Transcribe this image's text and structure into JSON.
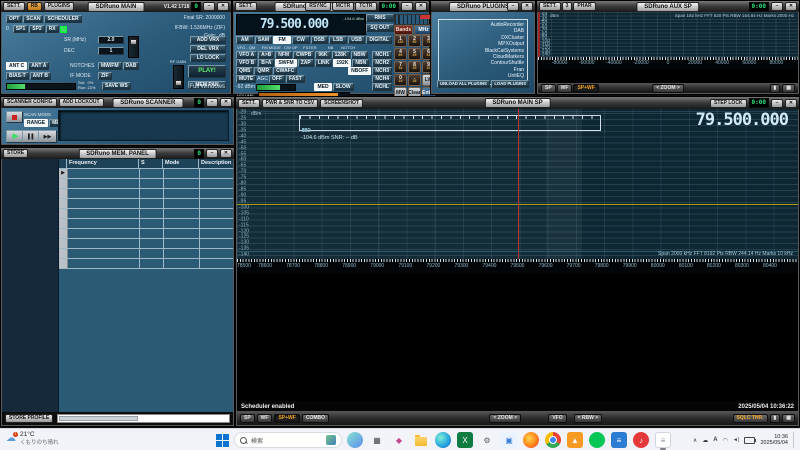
{
  "main_win": {
    "sett": "SETT.",
    "rb": "RB",
    "plugins_btn": "PLUGINS",
    "title": "SDRuno MAIN",
    "version": "V1.42 1718",
    "clock": "0",
    "row1": [
      {
        "t": "OPT"
      },
      {
        "t": "SCAN"
      },
      {
        "t": "SCHEDULER"
      }
    ],
    "final_sr": "Final SR: 2000000",
    "rx_num": "0",
    "row2": [
      {
        "t": "SP1"
      },
      {
        "t": "SP2"
      },
      {
        "t": "RX"
      }
    ],
    "ifbw": "IFBW: 1.536MHz (ZIF)",
    "gain": "Gain:  dB",
    "sr_label": "SR (MHz)",
    "sr_value": "2.0",
    "dec_label": "DEC",
    "dec_value": "1",
    "add_vrx": "ADD VRX",
    "del_vrx": "DEL VRX",
    "lo_lock": "LO LOCK",
    "ant_row1": [
      {
        "t": "ANT C",
        "on": true
      },
      {
        "t": "ANT A"
      }
    ],
    "notches_label": "NOTCHES",
    "notches": [
      {
        "t": "MW/FM"
      },
      {
        "t": "DAB"
      }
    ],
    "ant_row2": [
      {
        "t": "BIAS-T"
      },
      {
        "t": "ANT B"
      }
    ],
    "ifmode_label": "IF MODE",
    "ifmode": "ZIF",
    "rfgain_label": "RF GAIN",
    "play": "PLAY!",
    "mem_pan": "MEM PAN",
    "cpu1": "Sdr:  0%",
    "cpu2": "Run: 22%",
    "save_ws": "SAVE WS",
    "full_windows": "Full Windows"
  },
  "rx_win": {
    "sett": "SETT.",
    "title": "SDRuno RX CONTROL",
    "rbtns": [
      {
        "t": "RSYNC"
      },
      {
        "t": "MCTR"
      },
      {
        "t": "TCTR"
      }
    ],
    "clock": "0:00",
    "freq": "79.500.000",
    "dbm": "-104.6 dBm",
    "rms": "RMS",
    "sq_out": "SQ OUT",
    "modes": [
      {
        "t": "AM"
      },
      {
        "t": "SAM"
      },
      {
        "t": "FM",
        "on": true
      },
      {
        "t": "CW"
      },
      {
        "t": "DSB"
      },
      {
        "t": "LSB"
      },
      {
        "t": "USB"
      },
      {
        "t": "DIGITAL"
      }
    ],
    "col_labels": "VFO - QM      FM MODE   CW OP     FILTER          NB       NOTCH",
    "grid_r1": [
      {
        "t": "VFO A"
      },
      {
        "t": "A>B"
      },
      {
        "t": "NFM"
      },
      {
        "t": "CWPB"
      },
      {
        "t": "96K"
      },
      {
        "t": "128K"
      },
      {
        "t": "NBW"
      },
      {
        "t": "NCH1",
        "cls": "mla"
      }
    ],
    "grid_r2": [
      {
        "t": "VFO B"
      },
      {
        "t": "B>A"
      },
      {
        "t": "SWFM",
        "on": true
      },
      {
        "t": "ZAP"
      },
      {
        "t": "LINK"
      },
      {
        "t": "192K",
        "on": true
      },
      {
        "t": "NBN"
      },
      {
        "t": "NCH2",
        "cls": "mla"
      }
    ],
    "grid_r3": [
      {
        "t": "QMS"
      },
      {
        "t": "QMR"
      },
      {
        "t": "CWAFC"
      },
      {
        "t": "NBOFF",
        "on": true,
        "cls": "mla"
      },
      {
        "t": "NCH3",
        "cls": "mla2"
      }
    ],
    "grid_r4": [
      {
        "t": "MUTE"
      },
      {
        "t": "AGC",
        "cls": "lbl mla"
      },
      {
        "t": "OFF"
      },
      {
        "t": "FAST"
      },
      {
        "t": "NCH4",
        "cls": "mla"
      }
    ],
    "grid_r5": [
      {
        "t": "-92 dBm",
        "cls": "lbl"
      },
      {
        "cls": "gbar"
      },
      {
        "t": "MED",
        "on": true,
        "cls": "mla"
      },
      {
        "t": "SLOW"
      },
      {
        "t": "NCHL",
        "cls": "mla"
      }
    ],
    "volume_label": "VOLUME",
    "keypad_top": [
      {
        "t": "Bands",
        "cls": "kred kwide"
      },
      {
        "t": "MHz",
        "cls": "kblue kwide"
      }
    ],
    "keypad": [
      [
        {
          "t": "1",
          "sub": "120"
        },
        {
          "t": "2",
          "sub": "90"
        },
        {
          "t": "3",
          "sub": "75"
        }
      ],
      [
        {
          "t": "4",
          "sub": "60"
        },
        {
          "t": "5",
          "sub": "49"
        },
        {
          "t": "6",
          "sub": "41"
        }
      ],
      [
        {
          "t": "7",
          "sub": "31"
        },
        {
          "t": "8",
          "sub": "25"
        },
        {
          "t": "9",
          "sub": "22"
        }
      ],
      [
        {
          "t": "0",
          "sub": "19"
        },
        {
          "t": ".",
          "sub": "16"
        },
        {
          "t": "LW",
          "cls": "ksil"
        }
      ],
      [
        {
          "t": "MW",
          "cls": "ksil"
        },
        {
          "t": "Clear",
          "cls": "ksil"
        },
        {
          "t": "Enter",
          "cls": "kblue"
        }
      ]
    ]
  },
  "plugins_win": {
    "title": "SDRuno PLUGINS",
    "items": [
      "AudioRecorder",
      "DAB",
      "DXCluster",
      "MPXOutput",
      "BlackCatSystems",
      "CloudMarkers",
      "ContourShuttle",
      "Fran",
      "UnitEQ"
    ],
    "unload": "UNLOAD ALL PLUGINS",
    "load": "LOAD PLUGINS"
  },
  "aux_win": {
    "lbtns": [
      {
        "t": "SETT."
      },
      {
        "t": "3"
      },
      {
        "t": "PHAR"
      }
    ],
    "title": "SDRuno AUX SP",
    "clock": "0:00",
    "dbm_label": "dBm",
    "info": "Span 192 kHz  FFT 620 Pts  RBW 154.84 Hz  Marks 2000 Hz",
    "y_ticks": [
      "-20",
      "-30",
      "-40",
      "-50",
      "-60",
      "-70",
      "-80",
      "-90",
      "-100",
      "-110",
      "-120",
      "-130",
      "-140"
    ],
    "x_ticks": [
      "-80000",
      "-60000",
      "-40000",
      "-20000",
      "0",
      "20000",
      "40000",
      "60000",
      "80000"
    ],
    "bottom": [
      {
        "t": "SP"
      },
      {
        "t": "WF"
      },
      {
        "t": "SP+WF",
        "on": true
      }
    ],
    "zoom": "<  ZOOM  >",
    "icon1": "▮",
    "icon2": "▦"
  },
  "scanner_win": {
    "config": "SCANNER CONFIG",
    "add_lockout": "ADD LOCKOUT",
    "title": "SDRuno SCANNER",
    "clock": "0",
    "scan_mode": "SCAN MODE",
    "mode_btns": [
      {
        "t": "RANGE",
        "on": true
      },
      {
        "t": "MEM"
      }
    ],
    "play": "▶",
    "pause": "▌▌",
    "skip": "▶▶"
  },
  "mem_win": {
    "store": "STORE",
    "title": "SDRuno MEM. PANEL",
    "clock": "0",
    "columns": [
      "Frequency",
      "S",
      "Mode",
      "Description"
    ],
    "row_count": 10,
    "row_marker": "▶",
    "store_profile": "STORE PROFILE"
  },
  "mainsp_win": {
    "sett": "SETT.",
    "pwr_csv": "PWR & SNR TO CSV",
    "screenshot": "SCREENSHOT",
    "title": "SDRuno MAIN SP",
    "step_lock": "STEP LOCK",
    "clock": "0:00",
    "dbm_label": "dBm",
    "freq": "79.500.000",
    "smeter_ticks": [
      "0",
      "1",
      "2",
      "3",
      "4",
      "5",
      "6",
      "7",
      "8",
      "9",
      "+10",
      "+20",
      "+30",
      "+40",
      "+50",
      "+60"
    ],
    "level_text": "-104.6 dBm    SNR: -- dB",
    "info": "Span 2000 kHz  FFT 8192 Pts  RBW 244.14 Hz  Marks 10 kHz",
    "y_ticks": [
      "-20",
      "-25",
      "-30",
      "-35",
      "-40",
      "-45",
      "-50",
      "-55",
      "-60",
      "-65",
      "-70",
      "-75",
      "-80",
      "-85",
      "-90",
      "-95",
      "-100",
      "-105",
      "-110",
      "-115",
      "-120",
      "-125",
      "-130",
      "-135",
      "-140"
    ],
    "x_ticks": [
      "78500",
      "78600",
      "78700",
      "78800",
      "78900",
      "79000",
      "79100",
      "79200",
      "79300",
      "79400",
      "79500",
      "79600",
      "79700",
      "79800",
      "79900",
      "80000",
      "80100",
      "80200",
      "80300",
      "80400"
    ],
    "scheduler": "Scheduler enabled",
    "timestamp": "2025/05/04 10:36:22",
    "bottom_left": [
      {
        "t": "SP"
      },
      {
        "t": "WF"
      },
      {
        "t": "SP+WF",
        "on": true
      },
      {
        "t": "COMBO"
      }
    ],
    "zoom": "<  ZOOM  >",
    "vfo": "VFO",
    "rbw": "<  RBW  >",
    "sqlc": "SQLC THR.",
    "icon1": "▮",
    "icon2": "▦",
    "squelch_line_dbm": -95,
    "tuned_freq_khz": 79500
  },
  "taskbar": {
    "weather_temp": "21°C",
    "weather_desc": "くもりのち晴れ",
    "weather_badge": "1",
    "search_placeholder": "検索",
    "icons": [
      {
        "n": "copilot-icon",
        "bg": "linear-gradient(135deg,#86e3ce,#5b8def)",
        "cls": "round"
      },
      {
        "n": "task-view-icon",
        "bg": "#f2f4f7",
        "g": "▦",
        "gc": "#41464d"
      },
      {
        "n": "photos-icon",
        "bg": "#f2f4f7",
        "g": "◆",
        "gc": "#c2498f"
      },
      {
        "n": "file-explorer-icon",
        "bg": "transparent",
        "cls": "isfolder"
      },
      {
        "n": "edge-icon",
        "bg": "radial-gradient(circle at 35% 35%,#7ef0d4,#2aa7e0 55%,#0b62c5)",
        "cls": "round"
      },
      {
        "n": "excel-icon",
        "bg": "#107c41",
        "g": "X",
        "gc": "#ffffff"
      },
      {
        "n": "settings-icon",
        "bg": "#f2f4f7",
        "g": "⚙",
        "gc": "#5a6068"
      },
      {
        "n": "gallery-icon",
        "bg": "#eaf2ff",
        "g": "▣",
        "gc": "#3b82d6"
      },
      {
        "n": "firefox-icon",
        "bg": "radial-gradient(circle at 40% 40%,#ffd54d,#ff7a18 60%,#e3306a)",
        "cls": "round"
      },
      {
        "n": "chrome-icon",
        "bg": "conic-gradient(#ea4335 0 33%,#34a853 33% 66%,#fbbc05 66% 100%)",
        "cls": "round chrome"
      },
      {
        "n": "app-orange-icon",
        "bg": "#f59a23",
        "g": "▲",
        "gc": "#ffffff"
      },
      {
        "n": "line-icon",
        "bg": "#06c755",
        "g": "",
        "cls": "round"
      },
      {
        "n": "lists-icon",
        "bg": "#2b7cd3",
        "g": "≡",
        "gc": "#ffffff"
      },
      {
        "n": "music-icon",
        "bg": "#e5383b",
        "g": "♪",
        "gc": "#ffffff",
        "cls": "round"
      },
      {
        "n": "notepad-icon",
        "bg": "#ffffff",
        "g": "≡",
        "gc": "#8a9099",
        "cls": "active"
      }
    ],
    "tray": {
      "chevron": "∧",
      "cloud": "☁",
      "ime": "A",
      "wifi": "◠",
      "volume": "◄)"
    },
    "time": "10:36",
    "date": "2025/05/04"
  },
  "colors": {
    "panel_teal": "#2b5a7a",
    "led_green": "#27e57d",
    "accent_amber": "#f5a623",
    "squelch_yellow": "#a99a12",
    "tune_red": "#c03333",
    "freq_cyan": "#bfe6f8"
  }
}
